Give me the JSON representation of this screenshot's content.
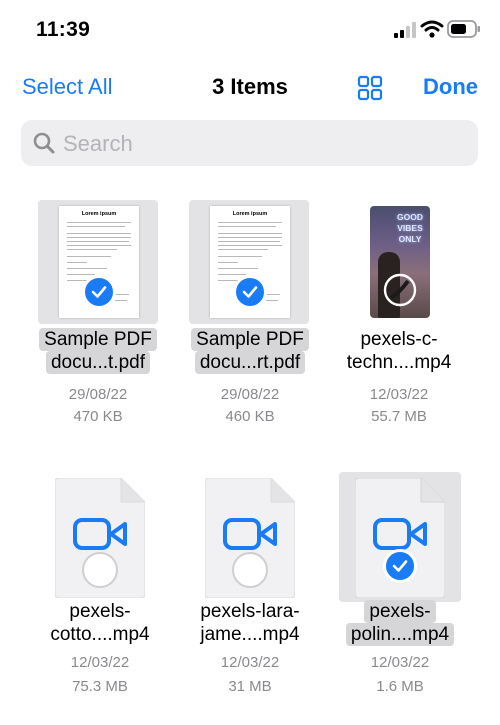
{
  "status": {
    "time": "11:39"
  },
  "nav": {
    "select_all": "Select All",
    "title": "3 Items",
    "done": "Done",
    "view_icon": "grid-view-icon"
  },
  "search": {
    "placeholder": "Search"
  },
  "colors": {
    "accent": "#1a7cf5",
    "selection_bg": "#e3e3e6"
  },
  "files": [
    {
      "name_line1": "Sample PDF",
      "name_line2": "docu...t.pdf",
      "date": "29/08/22",
      "size": "470 KB",
      "kind": "pdf",
      "selected": true,
      "doc_title": "Lorem ipsum"
    },
    {
      "name_line1": "Sample PDF",
      "name_line2": "docu...rt.pdf",
      "date": "29/08/22",
      "size": "460 KB",
      "kind": "pdf",
      "selected": true,
      "doc_title": "Lorem ipsum"
    },
    {
      "name_line1": "pexels-c-",
      "name_line2": "techn....mp4",
      "date": "12/03/22",
      "size": "55.7 MB",
      "kind": "video-thumb",
      "selected": false,
      "neon_text": "GOOD VIBES ONLY"
    },
    {
      "name_line1": "pexels-",
      "name_line2": "cotto....mp4",
      "date": "12/03/22",
      "size": "75.3 MB",
      "kind": "video",
      "selected": false
    },
    {
      "name_line1": "pexels-lara-",
      "name_line2": "jame....mp4",
      "date": "12/03/22",
      "size": "31 MB",
      "kind": "video",
      "selected": false
    },
    {
      "name_line1": "pexels-",
      "name_line2": "polin....mp4",
      "date": "12/03/22",
      "size": "1.6 MB",
      "kind": "video",
      "selected": true
    }
  ]
}
